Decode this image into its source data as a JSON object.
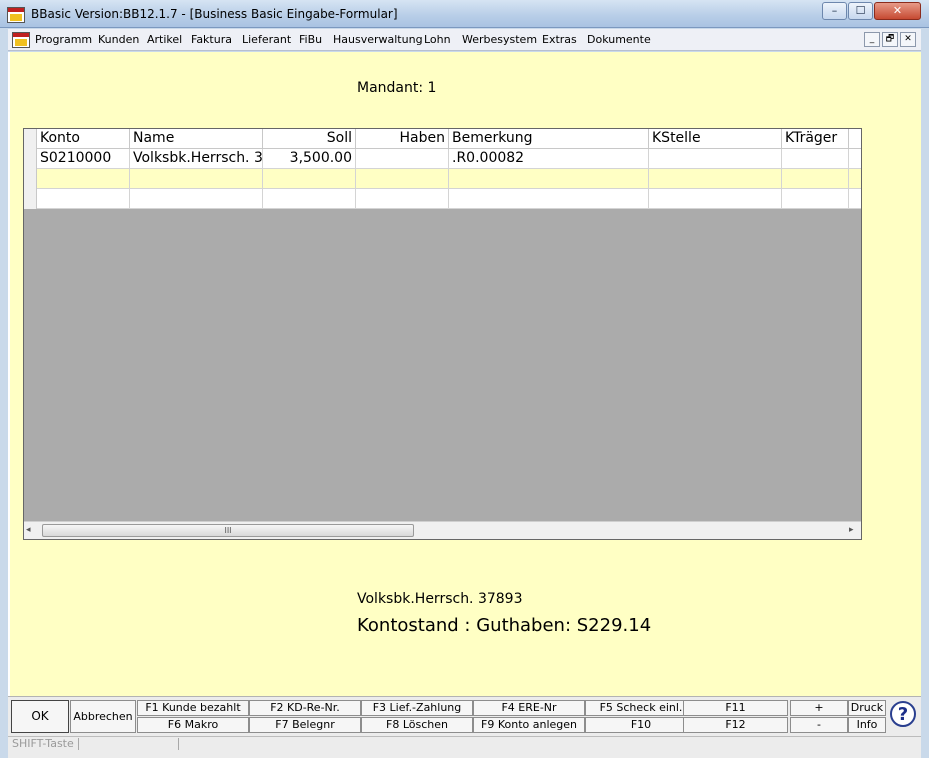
{
  "window": {
    "title": "BBasic Version:BB12.1.7 - [Business Basic Eingabe-Formular]",
    "min": "–",
    "max": "☐",
    "close": "✕"
  },
  "menu": {
    "items": [
      "Programm",
      "Kunden",
      "Artikel",
      "Faktura",
      "Lieferant",
      "FiBu",
      "Hausverwaltung",
      "Lohn",
      "Werbesystem",
      "Extras",
      "Dokumente"
    ],
    "mdi_min": "_",
    "mdi_restore": "🗗",
    "mdi_close": "✕"
  },
  "form": {
    "mandant": "Mandant: 1",
    "grid": {
      "columns": [
        "Konto",
        "Name",
        "Soll",
        "Haben",
        "Bemerkung",
        "KStelle",
        "KTräger"
      ],
      "rows": [
        [
          "S0210000",
          "Volksbk.Herrsch.  3",
          "3,500.00",
          "",
          ".R0.00082",
          "",
          ""
        ],
        [
          "",
          "",
          "",
          "",
          "",
          "",
          ""
        ],
        [
          "",
          "",
          "",
          "",
          "",
          "",
          ""
        ]
      ],
      "scroll_thumb": "III",
      "scroll_left": "◂",
      "scroll_right": "▸"
    },
    "account_line": "Volksbk.Herrsch.   37893",
    "balance": "Kontostand : Guthaben: S229.14"
  },
  "buttons": {
    "ok": "OK",
    "abbrechen": "Abbrechen",
    "f1": "F1 Kunde bezahlt",
    "f2": "F2 KD-Re-Nr.",
    "f3": "F3 Lief.-Zahlung",
    "f4": "F4 ERE-Nr",
    "f5": "F5 Scheck einl.",
    "f6": "F6 Makro",
    "f7": "F7 Belegnr",
    "f8": "F8 Löschen",
    "f9": "F9 Konto anlegen",
    "f10": "F10",
    "f11": "F11",
    "f12": "F12",
    "plus": "+",
    "minus": "-",
    "druck": "Druck",
    "info": "Info",
    "help": "?"
  },
  "status": {
    "text": "SHIFT-Taste"
  }
}
